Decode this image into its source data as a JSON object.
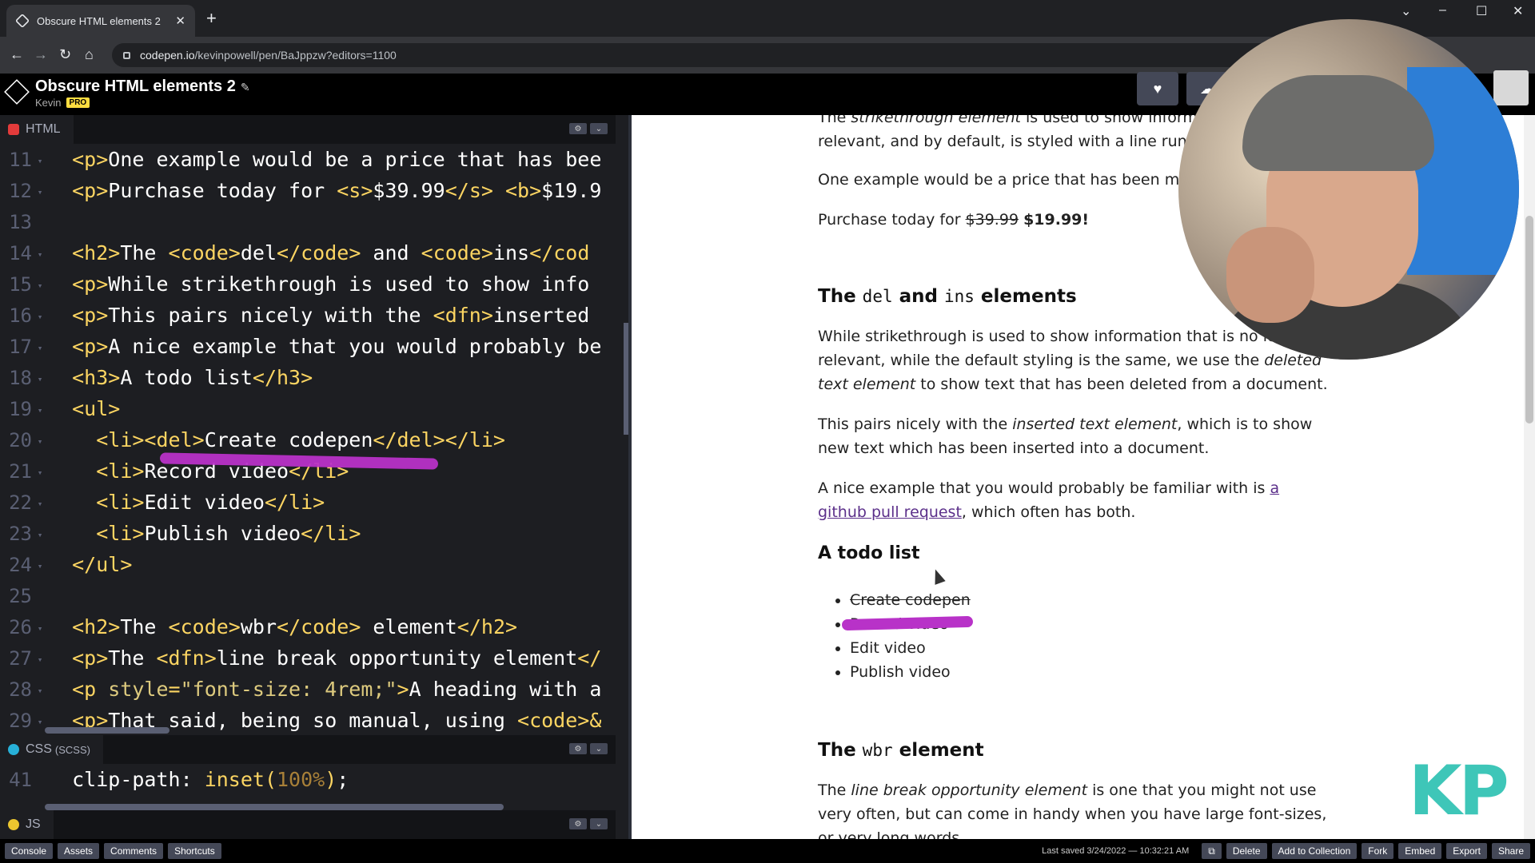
{
  "browser": {
    "tab_title": "Obscure HTML elements 2",
    "url_host": "codepen.io",
    "url_path": "/kevinpowell/pen/BaJppzw?editors=1100"
  },
  "header": {
    "title": "Obscure HTML elements 2",
    "user": "Kevin",
    "badge": "PRO"
  },
  "html_panel": {
    "label": "HTML",
    "lines": [
      {
        "n": "11",
        "html": "<span class='tg'>&lt;p&gt;</span>One example would be a price that has bee"
      },
      {
        "n": "12",
        "html": "<span class='tg'>&lt;p&gt;</span>Purchase today for <span class='tg'>&lt;s&gt;</span>$39.99<span class='tg'>&lt;/s&gt;</span> <span class='tg'>&lt;b&gt;</span>$19.9"
      },
      {
        "n": "13",
        "html": ""
      },
      {
        "n": "14",
        "html": "<span class='tg'>&lt;h2&gt;</span>The <span class='tg'>&lt;code&gt;</span>del<span class='tg'>&lt;/code&gt;</span> and <span class='tg'>&lt;code&gt;</span>ins<span class='tg'>&lt;/cod</span>"
      },
      {
        "n": "15",
        "html": "<span class='tg'>&lt;p&gt;</span>While strikethrough is used to show info"
      },
      {
        "n": "16",
        "html": "<span class='tg'>&lt;p&gt;</span>This pairs nicely with the <span class='tg'>&lt;dfn&gt;</span>inserted"
      },
      {
        "n": "17",
        "html": "<span class='tg'>&lt;p&gt;</span>A nice example that you would probably be"
      },
      {
        "n": "18",
        "html": "<span class='tg'>&lt;h3&gt;</span>A todo list<span class='tg'>&lt;/h3&gt;</span>"
      },
      {
        "n": "19",
        "html": "<span class='tg'>&lt;ul&gt;</span>"
      },
      {
        "n": "20",
        "html": "  <span class='tg'>&lt;li&gt;&lt;del&gt;</span>Create codepen<span class='tg'>&lt;/del&gt;&lt;/li&gt;</span>"
      },
      {
        "n": "21",
        "html": "  <span class='tg'>&lt;li&gt;</span>Record video<span class='tg'>&lt;/li&gt;</span>"
      },
      {
        "n": "22",
        "html": "  <span class='tg'>&lt;li&gt;</span>Edit video<span class='tg'>&lt;/li&gt;</span>"
      },
      {
        "n": "23",
        "html": "  <span class='tg'>&lt;li&gt;</span>Publish video<span class='tg'>&lt;/li&gt;</span>"
      },
      {
        "n": "24",
        "html": "<span class='tg'>&lt;/ul&gt;</span>"
      },
      {
        "n": "25",
        "html": ""
      },
      {
        "n": "26",
        "html": "<span class='tg'>&lt;h2&gt;</span>The <span class='tg'>&lt;code&gt;</span>wbr<span class='tg'>&lt;/code&gt;</span> element<span class='tg'>&lt;/h2&gt;</span>"
      },
      {
        "n": "27",
        "html": "<span class='tg'>&lt;p&gt;</span>The <span class='tg'>&lt;dfn&gt;</span>line break opportunity element<span class='tg'>&lt;/</span>"
      },
      {
        "n": "28",
        "html": "<span class='tg'>&lt;p </span><span class='at'>style</span><span class='tg'>=</span><span class='at'>\"font-size: 4rem;\"</span><span class='tg'>&gt;</span>A heading with a"
      },
      {
        "n": "29",
        "html": "<span class='tg'>&lt;p&gt;</span>That said, being so manual, using <span class='tg'>&lt;code&gt;&amp;</span>"
      }
    ]
  },
  "css_panel": {
    "label": "CSS",
    "sublabel": "(SCSS)",
    "line_number": "41",
    "line_html": "<span class='tx'>clip-path: </span><span class='tg'>inset(</span><span class='vl'>100%</span><span class='tg'>)</span><span class='tx'>;</span>"
  },
  "js_panel": {
    "label": "JS"
  },
  "preview": {
    "p_strike_1": "The ",
    "p_strike_em": "strikethrough element",
    "p_strike_2": " is used to show information",
    "p_strike_3": "relevant, and by default, is styled with a line running",
    "p_example": "One example would be a price that has been marke",
    "p_purchase": "Purchase today for ",
    "price_old": "$39.99",
    "price_new": "$19.99!",
    "h2_del_1": "The ",
    "h2_del_code": "del",
    "h2_del_2": " and ",
    "h2_del_code2": "ins",
    "h2_del_3": " elements",
    "p_while_1": "While strikethrough is used to show information that is no longe",
    "p_while_2": "relevant, while the default styling is the same, we use the ",
    "p_while_em": "deleted text element",
    "p_while_3": " to show text that has been deleted from a document.",
    "p_pairs_1": "This pairs nicely with the ",
    "p_pairs_em": "inserted text element",
    "p_pairs_2": ", which is to show new text which has been inserted into a document.",
    "p_nice_1": "A nice example that you would probably be familiar with is ",
    "p_nice_link": "a github pull request",
    "p_nice_2": ", which often has both.",
    "h3_todo": "A todo list",
    "todo": [
      "Create codepen",
      "Record video",
      "Edit video",
      "Publish video"
    ],
    "h2_wbr_1": "The ",
    "h2_wbr_code": "wbr",
    "h2_wbr_2": " element",
    "p_wbr_1": "The ",
    "p_wbr_em": "line break opportunity element",
    "p_wbr_2": " is one that you might not use very often, but can come in handy when you have large font-sizes, or very long words."
  },
  "watermark": "KP",
  "footer": {
    "buttons": [
      "Console",
      "Assets",
      "Comments",
      "Shortcuts"
    ],
    "saved": "Last saved 3/24/2022 — 10:32:21 AM",
    "right_buttons": [
      "Delete",
      "Add to Collection",
      "Fork",
      "Embed",
      "Export",
      "Share"
    ]
  },
  "colors": {
    "accent_marker": "#b832c8",
    "code_tag": "#fcd562",
    "kp": "#3ec6b8"
  }
}
